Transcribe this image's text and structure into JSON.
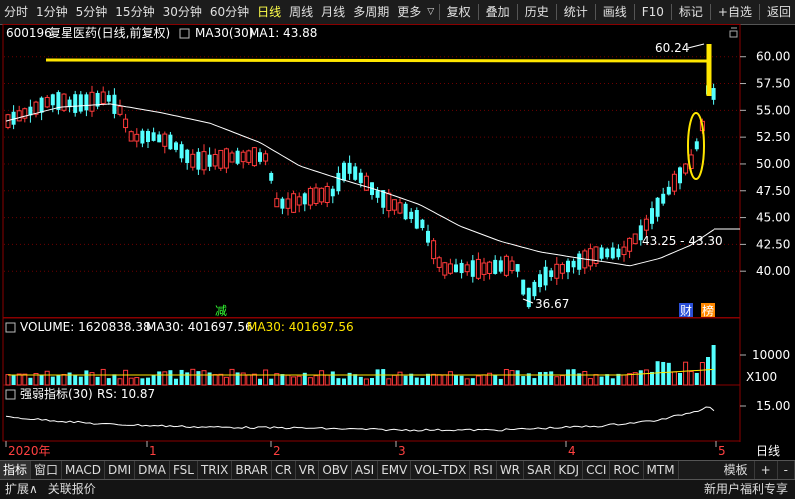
{
  "toolbar": {
    "items": [
      "分时",
      "1分钟",
      "5分钟",
      "15分钟",
      "30分钟",
      "60分钟",
      "日线",
      "周线",
      "月线",
      "多周期",
      "更多"
    ],
    "active_index": 6,
    "more_arrow": "▽",
    "right": [
      "复权",
      "叠加",
      "历史",
      "统计",
      "画线",
      "F10",
      "标记",
      "+自选",
      "返回"
    ]
  },
  "colors": {
    "up": "#ff3a3a",
    "down": "#54ffff",
    "ma": "#ffffff",
    "highlight": "#ffe600",
    "grid": "#7a0000",
    "axis": "#b0b0b0",
    "rs": "#ffffff"
  },
  "price_panel": {
    "code": "600196",
    "name": "复星医药(日线,前复权)",
    "ma_label": "MA30(30)",
    "ma_value": "MA1: 43.88",
    "y_ticks": [
      "60.00",
      "57.50",
      "55.00",
      "52.50",
      "50.00",
      "47.50",
      "45.00",
      "42.50",
      "40.00"
    ],
    "annotations": {
      "high": "60.24",
      "low": "36.67",
      "range": "43.25 - 43.30"
    },
    "tags": {
      "reduce": "减",
      "finance": "财",
      "board": "榜"
    }
  },
  "volume_panel": {
    "label": "VOLUME: 1620838.38",
    "ma_label": "MA30: 401697.56",
    "ma_label2": "MA30: 401697.56",
    "y_tick": "10000",
    "unit": "X100"
  },
  "rs_panel": {
    "label": "强弱指标(30)",
    "value": "RS: 10.87",
    "y_tick": "15.00"
  },
  "x_axis": {
    "labels": [
      "2020年",
      "1",
      "2",
      "3",
      "4",
      "5"
    ],
    "period": "日线"
  },
  "indicator_tabs": {
    "items": [
      "指标",
      "窗口",
      "MACD",
      "DMI",
      "DMA",
      "FSL",
      "TRIX",
      "BRAR",
      "CR",
      "VR",
      "OBV",
      "ASI",
      "EMV",
      "VOL-TDX",
      "RSI",
      "WR",
      "SAR",
      "KDJ",
      "CCI",
      "ROC",
      "MTM"
    ],
    "active_index": 0,
    "right": [
      "模板",
      "+",
      "-"
    ]
  },
  "status": {
    "expand": "扩展∧",
    "link": "关联报价",
    "ad": "新用户福利专享"
  },
  "chart_data": {
    "type": "candlestick",
    "title": "600196 复星医药(日线,前复权)",
    "x_labels": [
      "2020年",
      "1",
      "2",
      "3",
      "4",
      "5"
    ],
    "price_ylim": [
      37.5,
      61.0
    ],
    "annotated_high": 60.24,
    "annotated_low": 36.67,
    "ma30_last": 43.88,
    "ma30_range": [
      43.25,
      43.3
    ],
    "volume_last": 1620838.38,
    "volume_ma30": 401697.56,
    "rs_last": 10.87,
    "rs_tick": 15.0
  }
}
